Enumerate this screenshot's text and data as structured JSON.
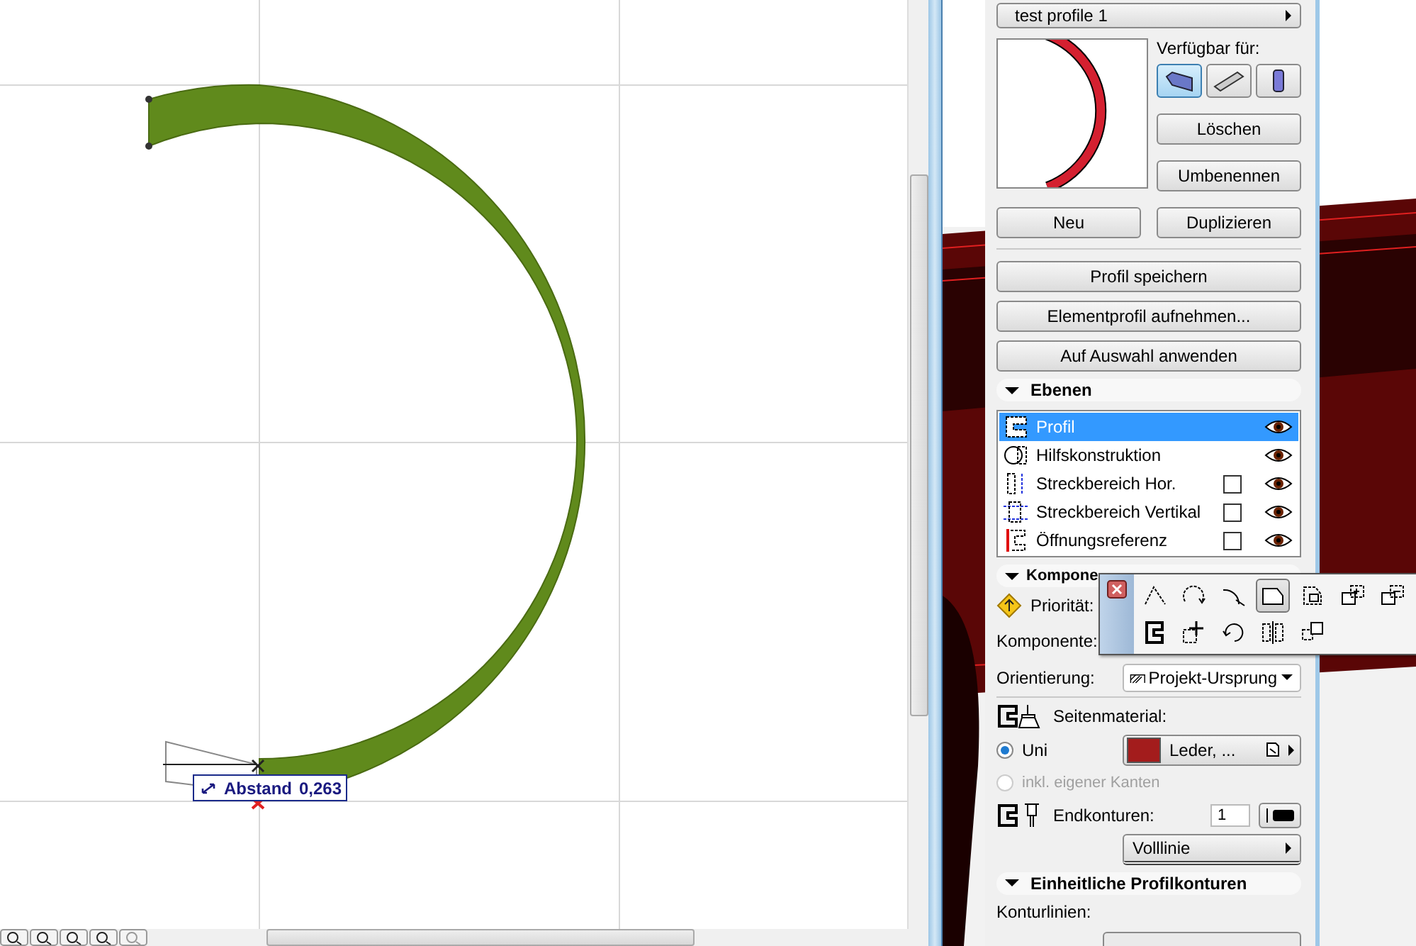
{
  "canvas": {
    "tooltip": {
      "label": "Abstand",
      "value": "0,263"
    }
  },
  "profile_selector": {
    "value": "test profile 1"
  },
  "availability": {
    "label": "Verfügbar für:",
    "options": [
      {
        "kind": "slab",
        "selected": true
      },
      {
        "kind": "beam",
        "selected": false
      },
      {
        "kind": "column",
        "selected": false
      }
    ]
  },
  "side_buttons": [
    "Löschen",
    "Umbenennen"
  ],
  "row_buttons": [
    "Neu",
    "Duplizieren"
  ],
  "wide_buttons": [
    "Profil speichern",
    "Elementprofil aufnehmen...",
    "Auf Auswahl anwenden"
  ],
  "layers": {
    "title": "Ebenen",
    "expanded": true,
    "items": [
      {
        "label": "Profil",
        "kind": "profile",
        "selected": true,
        "visible": true
      },
      {
        "label": "Hilfskonstruktion",
        "kind": "guide",
        "selected": false,
        "visible": true
      },
      {
        "label": "Streckbereich Hor.",
        "kind": "stretch_h",
        "selected": false,
        "checked": false,
        "visible": true
      },
      {
        "label": "Streckbereich Vertikal",
        "kind": "stretch_v",
        "selected": false,
        "checked": false,
        "visible": true
      },
      {
        "label": "Öffnungsreferenz",
        "kind": "opening",
        "selected": false,
        "checked": false,
        "visible": true
      }
    ]
  },
  "components": {
    "title": "Kompone",
    "expanded": true,
    "priority_label": "Priorität:",
    "component_label": "Komponente:",
    "orientation": {
      "label": "Orientierung:",
      "value": "Projekt-Ursprung"
    },
    "side_material": {
      "label": "Seitenmaterial:",
      "options": [
        {
          "label": "Uni",
          "selected": true,
          "disabled": false
        },
        {
          "label": "inkl. eigener Kanten",
          "selected": false,
          "disabled": true
        }
      ],
      "material": {
        "name": "Leder, ...",
        "color": "#a31c1c"
      }
    },
    "end_contours": {
      "label": "Endkonturen:",
      "pen": "1",
      "line_type": "Volllinie"
    }
  },
  "uniform_contours": {
    "title": "Einheitliche Profilkonturen",
    "expanded": true,
    "label": "Konturlinien:"
  },
  "palette": {
    "tools": [
      {
        "kind": "corner",
        "selected": false
      },
      {
        "kind": "rotate",
        "selected": false
      },
      {
        "kind": "arc",
        "selected": false
      },
      {
        "kind": "polygon",
        "selected": true
      },
      {
        "kind": "subtract",
        "selected": false
      },
      {
        "kind": "add",
        "selected": false
      },
      {
        "kind": "remove",
        "selected": false
      },
      {
        "kind": "outline",
        "selected": false
      },
      {
        "kind": "move",
        "selected": false
      },
      {
        "kind": "rotate_copy",
        "selected": false
      },
      {
        "kind": "mirror",
        "selected": false
      },
      {
        "kind": "offset",
        "selected": false
      }
    ]
  }
}
